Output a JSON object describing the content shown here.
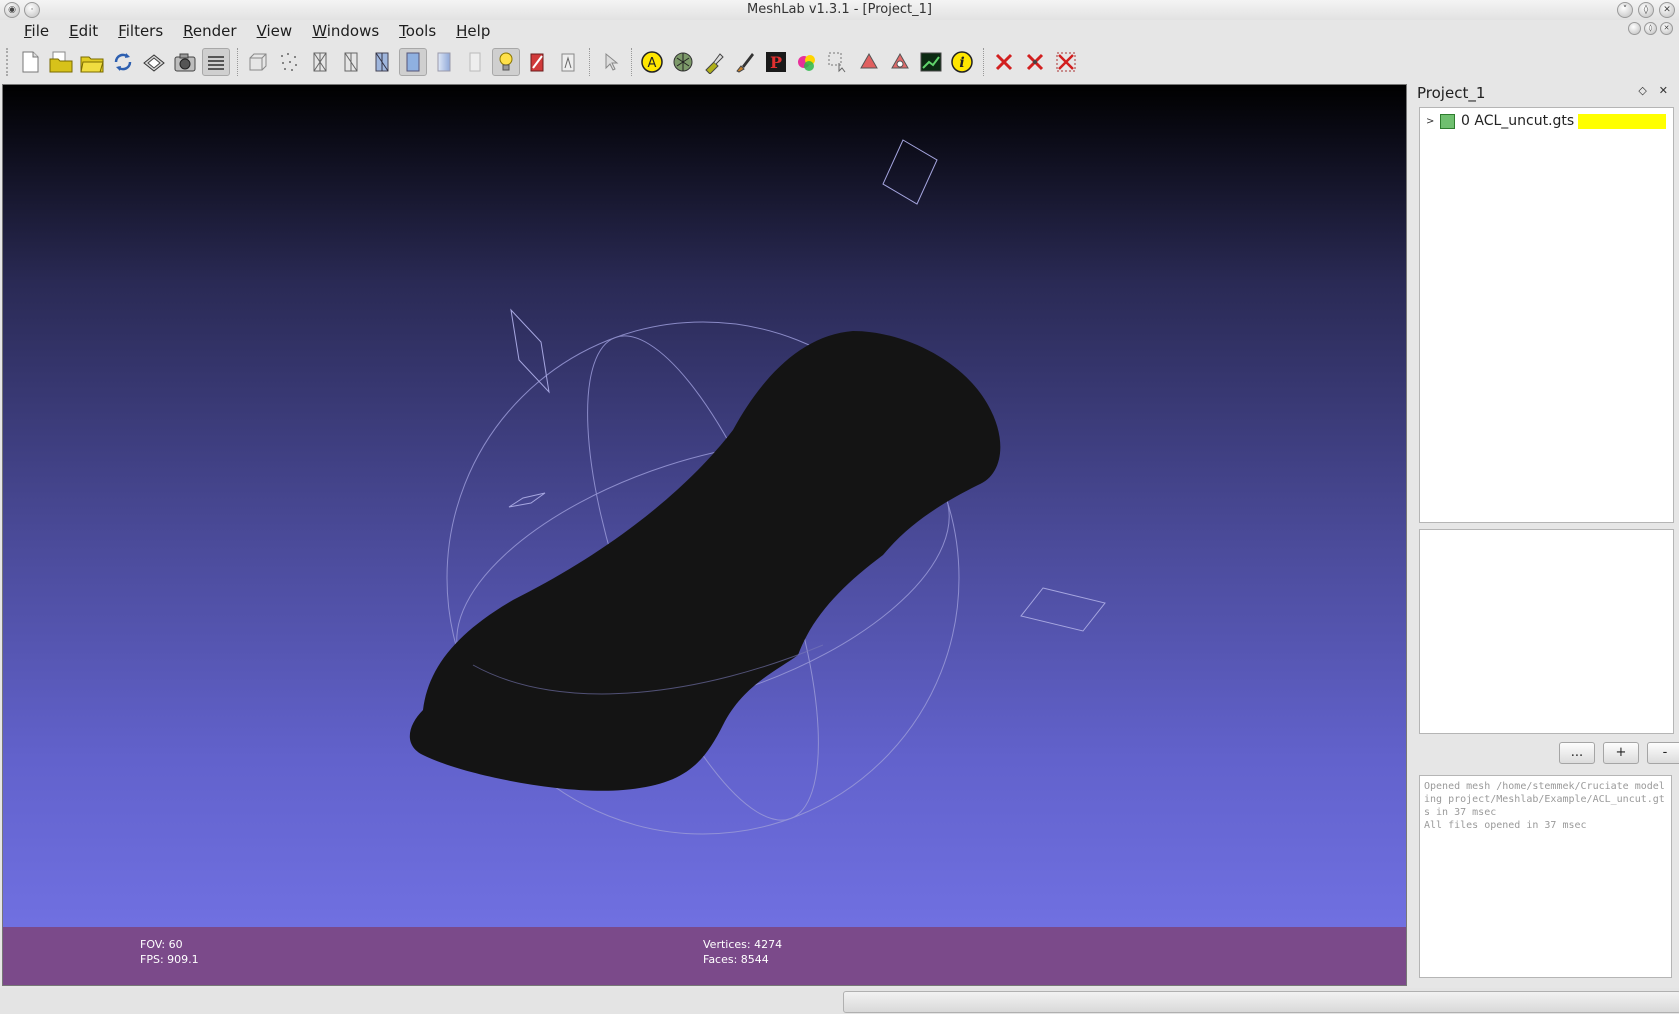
{
  "window": {
    "title": "MeshLab v1.3.1 - [Project_1]"
  },
  "menubar": {
    "items": [
      "File",
      "Edit",
      "Filters",
      "Render",
      "View",
      "Windows",
      "Tools",
      "Help"
    ]
  },
  "toolbar": {
    "icons": [
      "new-project-icon",
      "open-project-icon",
      "open-mesh-icon",
      "reload-icon",
      "save-icon",
      "snapshot-icon",
      "layers-icon",
      "bbox-icon",
      "points-icon",
      "wireframe-icon",
      "hidden-lines-icon",
      "flat-lines-icon",
      "flat-icon",
      "smooth-icon",
      "texture-icon",
      "lighting-icon",
      "color-mode-icon",
      "normals-icon",
      "select-icon",
      "annotation-icon",
      "manipulator-icon",
      "paint-icon",
      "brush-icon",
      "pick-points-icon",
      "color-paint-icon",
      "select-faces-icon",
      "select-vertices-icon",
      "select-connected-icon",
      "raster-icon",
      "info-icon",
      "delete-faces-icon",
      "delete-vertices-icon",
      "delete-selection-icon"
    ]
  },
  "viewport": {
    "fov": "FOV: 60",
    "fps": "FPS:  909.1",
    "vertices": "Vertices: 4274",
    "faces": "Faces: 8544",
    "colors": {
      "mesh": "#141414",
      "infobar": "#7b4a8a",
      "trackball": "#9a9ad8"
    }
  },
  "panel": {
    "title": "Project_1",
    "float_icon": "◇",
    "close_icon": "✕",
    "layers": [
      {
        "label": "0  ACL_uncut.gts",
        "color": "#ffff00"
      }
    ],
    "buttons": {
      "more": "...",
      "add": "+",
      "remove": "-"
    },
    "log": [
      "Opened mesh /home/stemmek/Cruciate modeling project/Meshlab/Example/ACL_uncut.gts in 37 msec",
      "All files opened in 37 msec"
    ]
  }
}
